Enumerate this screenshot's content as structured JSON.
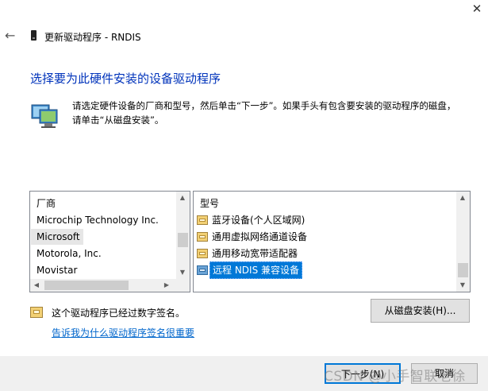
{
  "window": {
    "title": "更新驱动程序 - RNDIS",
    "close_glyph": "✕",
    "back_glyph": "←",
    "device_icon": "device-icon"
  },
  "heading": "选择要为此硬件安装的设备驱动程序",
  "description": "请选定硬件设备的厂商和型号，然后单击“下一步”。如果手头有包含要安装的驱动程序的磁盘，\n请单击“从磁盘安装”。",
  "manufacturer_list": {
    "header": "厂商",
    "items": [
      {
        "label": "Microchip Technology Inc."
      },
      {
        "label": "Microsoft",
        "selected": true
      },
      {
        "label": "Motorola, Inc."
      },
      {
        "label": "Movistar"
      }
    ]
  },
  "model_list": {
    "header": "型号",
    "items": [
      {
        "label": "蓝牙设备(个人区域网)",
        "icon": "driver-icon"
      },
      {
        "label": "通用虚拟网络通道设备",
        "icon": "driver-icon"
      },
      {
        "label": "通用移动宽带适配器",
        "icon": "driver-icon"
      },
      {
        "label": "远程 NDIS 兼容设备",
        "icon": "network-driver-icon",
        "selected": true
      }
    ]
  },
  "signature": {
    "text": "这个驱动程序已经过数字签名。",
    "link": "告诉我为什么驱动程序签名很重要"
  },
  "buttons": {
    "have_disk": "从磁盘安装(H)...",
    "next": "下一步(N)",
    "cancel": "取消"
  },
  "scroll_glyphs": {
    "up": "▲",
    "down": "▼",
    "left": "◀",
    "right": "▶"
  },
  "watermark": "CSDN @小手智联老徐",
  "colors": {
    "accent": "#0078d7",
    "heading": "#0033bb",
    "link": "#0066cc"
  }
}
